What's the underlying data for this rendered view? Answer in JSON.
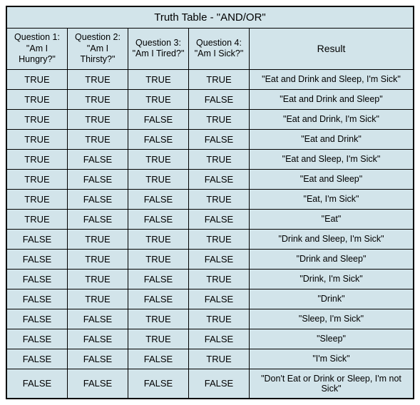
{
  "chart_data": {
    "type": "table",
    "title": "Truth Table - \"AND/OR\"",
    "headers": {
      "q1": "Question 1:\n\"Am I Hungry?\"",
      "q2": "Question 2:\n\"Am I Thirsty?\"",
      "q3": "Question 3:\n\"Am I Tired?\"",
      "q4": "Question 4:\n\"Am I Sick?\"",
      "result": "Result"
    },
    "rows": [
      {
        "q1": "TRUE",
        "q2": "TRUE",
        "q3": "TRUE",
        "q4": "TRUE",
        "result": "\"Eat and Drink and Sleep, I'm Sick\""
      },
      {
        "q1": "TRUE",
        "q2": "TRUE",
        "q3": "TRUE",
        "q4": "FALSE",
        "result": "\"Eat and Drink and Sleep\""
      },
      {
        "q1": "TRUE",
        "q2": "TRUE",
        "q3": "FALSE",
        "q4": "TRUE",
        "result": "\"Eat and Drink, I'm Sick\""
      },
      {
        "q1": "TRUE",
        "q2": "TRUE",
        "q3": "FALSE",
        "q4": "FALSE",
        "result": "\"Eat and Drink\""
      },
      {
        "q1": "TRUE",
        "q2": "FALSE",
        "q3": "TRUE",
        "q4": "TRUE",
        "result": "\"Eat and Sleep, I'm Sick\""
      },
      {
        "q1": "TRUE",
        "q2": "FALSE",
        "q3": "TRUE",
        "q4": "FALSE",
        "result": "\"Eat and Sleep\""
      },
      {
        "q1": "TRUE",
        "q2": "FALSE",
        "q3": "FALSE",
        "q4": "TRUE",
        "result": "\"Eat, I'm Sick\""
      },
      {
        "q1": "TRUE",
        "q2": "FALSE",
        "q3": "FALSE",
        "q4": "FALSE",
        "result": "\"Eat\""
      },
      {
        "q1": "FALSE",
        "q2": "TRUE",
        "q3": "TRUE",
        "q4": "TRUE",
        "result": "\"Drink and Sleep, I'm Sick\""
      },
      {
        "q1": "FALSE",
        "q2": "TRUE",
        "q3": "TRUE",
        "q4": "FALSE",
        "result": "\"Drink and Sleep\""
      },
      {
        "q1": "FALSE",
        "q2": "TRUE",
        "q3": "FALSE",
        "q4": "TRUE",
        "result": "\"Drink, I'm Sick\""
      },
      {
        "q1": "FALSE",
        "q2": "TRUE",
        "q3": "FALSE",
        "q4": "FALSE",
        "result": "\"Drink\""
      },
      {
        "q1": "FALSE",
        "q2": "FALSE",
        "q3": "TRUE",
        "q4": "TRUE",
        "result": "\"Sleep, I'm Sick\""
      },
      {
        "q1": "FALSE",
        "q2": "FALSE",
        "q3": "TRUE",
        "q4": "FALSE",
        "result": "\"Sleep\""
      },
      {
        "q1": "FALSE",
        "q2": "FALSE",
        "q3": "FALSE",
        "q4": "TRUE",
        "result": "\"I'm Sick\""
      },
      {
        "q1": "FALSE",
        "q2": "FALSE",
        "q3": "FALSE",
        "q4": "FALSE",
        "result": "\"Don't Eat or Drink or Sleep, I'm not Sick\""
      }
    ]
  }
}
